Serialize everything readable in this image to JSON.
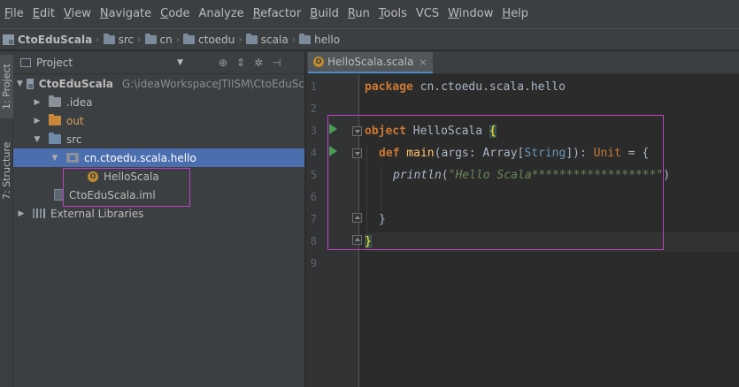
{
  "menu": {
    "items": [
      {
        "u": "F",
        "rest": "ile"
      },
      {
        "u": "E",
        "rest": "dit"
      },
      {
        "u": "V",
        "rest": "iew"
      },
      {
        "u": "N",
        "rest": "avigate"
      },
      {
        "u": "C",
        "rest": "ode"
      },
      {
        "u": "",
        "rest": "Analyze"
      },
      {
        "u": "R",
        "rest": "efactor"
      },
      {
        "u": "B",
        "rest": "uild"
      },
      {
        "u": "R",
        "rest": "un"
      },
      {
        "u": "T",
        "rest": "ools"
      },
      {
        "u": "",
        "rest": "VCS"
      },
      {
        "u": "W",
        "rest": "indow"
      },
      {
        "u": "H",
        "rest": "elp"
      }
    ]
  },
  "breadcrumbs": [
    "CtoEduScala",
    "src",
    "cn",
    "ctoedu",
    "scala",
    "hello"
  ],
  "toolwindows": {
    "project_tab": "1: Project",
    "structure_tab": "7: Structure"
  },
  "project_panel": {
    "title": "Project",
    "toolbar_icons": [
      "target-icon",
      "collapse-icon",
      "gear-icon",
      "hide-icon"
    ]
  },
  "tree": {
    "root_label": "CtoEduScala",
    "root_path": "G:\\ideaWorkspaceJTIISM\\CtoEduSc",
    "idea": ".idea",
    "out": "out",
    "src": "src",
    "package": "cn.ctoedu.scala.hello",
    "file": "HelloScala",
    "iml": "CtoEduScala.iml",
    "libs": "External Libraries"
  },
  "editor": {
    "tab_label": "HelloScala.scala",
    "line_numbers": [
      "1",
      "2",
      "3",
      "4",
      "5",
      "6",
      "7",
      "8",
      "9"
    ],
    "code": {
      "l1_kw": "package",
      "l1_rest": " cn.ctoedu.scala.hello",
      "l3_kw": "object",
      "l3_name": " HelloScala ",
      "l3_brace": "{",
      "l4_kw": "def",
      "l4_name": " main",
      "l4_args": "(args: Array[",
      "l4_tparam": "String",
      "l4_ret": "]): ",
      "l4_unit": "Unit",
      "l4_end": " = {",
      "l5_fn": "println",
      "l5_open": "(",
      "l5_str": "\"Hello Scala******************\"",
      "l5_close": ")",
      "l7": "}",
      "l8": "}"
    }
  },
  "colors": {
    "highlight_box": "#c13fc9",
    "selection": "#4b6eaf",
    "keyword": "#cc7832",
    "string": "#6a8759"
  }
}
